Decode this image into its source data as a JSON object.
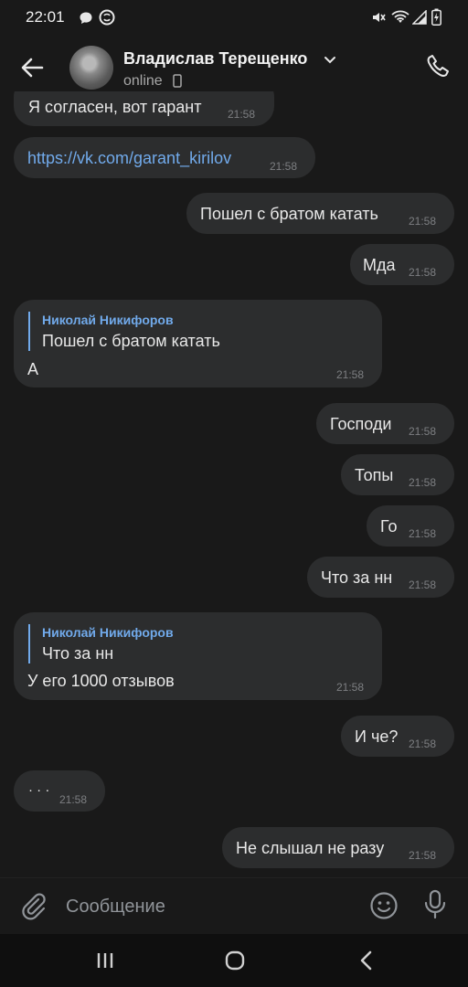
{
  "status_bar": {
    "time": "22:01"
  },
  "header": {
    "contact_name": "Владислав Терещенко",
    "presence": "online"
  },
  "messages": [
    {
      "side": "in",
      "text": "Я согласен, вот гарант",
      "time": "21:58"
    },
    {
      "side": "in",
      "text": "https://vk.com/garant_kirilov",
      "time": "21:58"
    },
    {
      "side": "out",
      "text": "Пошел с братом катать",
      "time": "21:58"
    },
    {
      "side": "out",
      "text": "Мда",
      "time": "21:58"
    },
    {
      "side": "in",
      "reply_author": "Николай Никифоров",
      "reply_text": "Пошел с братом катать",
      "text": "А",
      "time": "21:58"
    },
    {
      "side": "out",
      "text": "Господи",
      "time": "21:58"
    },
    {
      "side": "out",
      "text": "Топы",
      "time": "21:58"
    },
    {
      "side": "out",
      "text": "Го",
      "time": "21:58"
    },
    {
      "side": "out",
      "text": "Что за нн",
      "time": "21:58"
    },
    {
      "side": "in",
      "reply_author": "Николай Никифоров",
      "reply_text": "Что за нн",
      "text": "У его 1000 отзывов",
      "time": "21:58"
    },
    {
      "side": "out",
      "text": "И че?",
      "time": "21:58"
    },
    {
      "side": "in",
      "text": "· · ·",
      "time": "21:58"
    },
    {
      "side": "out",
      "text": "Не слышал не разу",
      "time": "21:58"
    }
  ],
  "composer": {
    "placeholder": "Сообщение"
  },
  "colors": {
    "background": "#191919",
    "bubble": "#2c2d2e",
    "accent": "#71aaeb"
  },
  "icons": [
    "message-icon",
    "app-icon",
    "mute-icon",
    "wifi-icon",
    "signal-icon",
    "battery-icon",
    "back-arrow-icon",
    "chevron-down-icon",
    "mobile-icon",
    "phone-icon",
    "attach-icon",
    "emoji-icon",
    "microphone-icon",
    "recents-icon",
    "home-icon",
    "nav-back-icon"
  ]
}
